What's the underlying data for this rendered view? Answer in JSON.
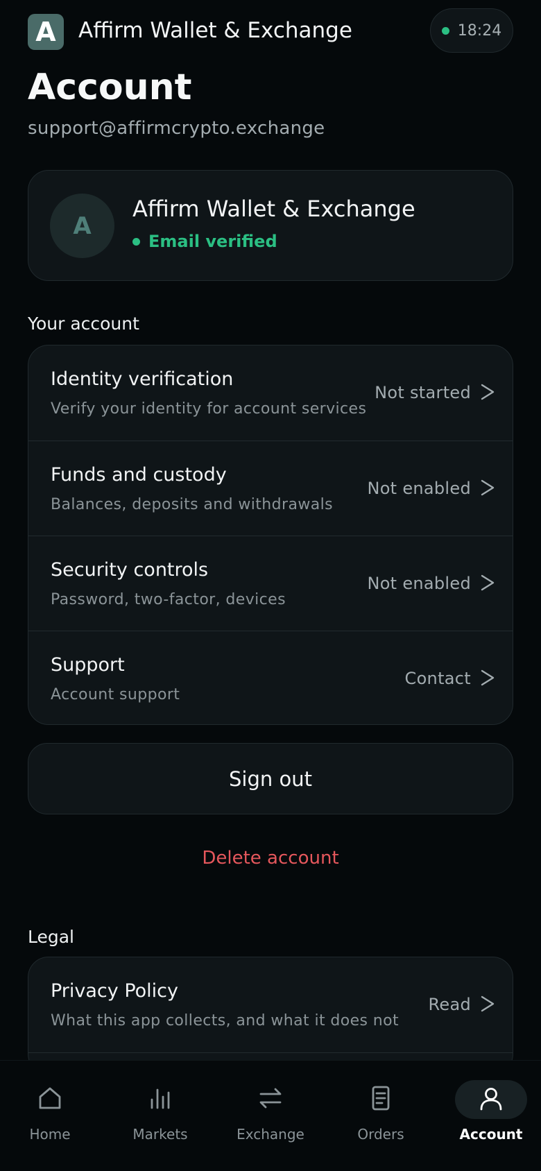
{
  "header": {
    "logo_letter": "A",
    "app_title": "Affirm Wallet & Exchange",
    "time": "18:24",
    "status_color": "#2bbf83"
  },
  "page": {
    "title": "Account",
    "email": "support@affirmcrypto.exchange"
  },
  "profile": {
    "avatar_letter": "A",
    "name": "Affirm Wallet & Exchange",
    "verified_text": "Email verified",
    "verified_color": "#2bbf83"
  },
  "your_account": {
    "label": "Your account",
    "items": [
      {
        "title": "Identity verification",
        "subtitle": "Verify your identity for account services",
        "status": "Not started"
      },
      {
        "title": "Funds and custody",
        "subtitle": "Balances, deposits and withdrawals",
        "status": "Not enabled"
      },
      {
        "title": "Security controls",
        "subtitle": "Password, two-factor, devices",
        "status": "Not enabled"
      },
      {
        "title": "Support",
        "subtitle": "Account support",
        "status": "Contact"
      }
    ]
  },
  "actions": {
    "sign_out": "Sign out",
    "delete_account": "Delete account",
    "delete_color": "#e5575c"
  },
  "legal": {
    "label": "Legal",
    "items": [
      {
        "title": "Privacy Policy",
        "subtitle": "What this app collects, and what it does not",
        "status": "Read"
      }
    ]
  },
  "nav": {
    "items": [
      {
        "label": "Home",
        "icon": "home-icon"
      },
      {
        "label": "Markets",
        "icon": "bar-chart-icon"
      },
      {
        "label": "Exchange",
        "icon": "swap-arrows-icon"
      },
      {
        "label": "Orders",
        "icon": "document-icon"
      },
      {
        "label": "Account",
        "icon": "user-icon",
        "active": true
      }
    ]
  }
}
